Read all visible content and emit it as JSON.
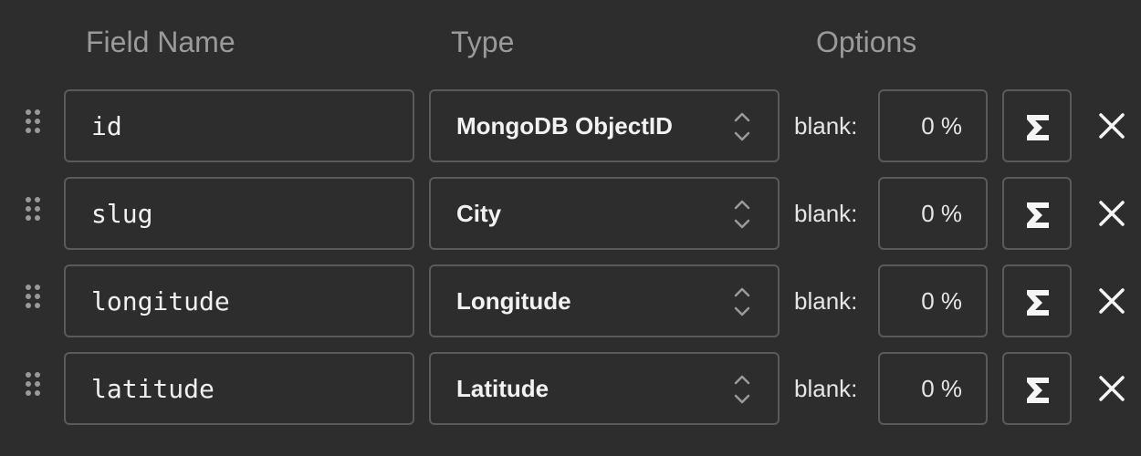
{
  "header": {
    "field_name": "Field Name",
    "type": "Type",
    "options": "Options"
  },
  "icons": {
    "drag": "drag-handle-icon",
    "select": "chevron-up-down-icon",
    "formula": "sigma-icon",
    "delete": "close-icon"
  },
  "colors": {
    "background": "#2d2d2d",
    "border": "#5a5a5a",
    "header_text": "#9a9a9a",
    "text": "#f0f0f0"
  },
  "rows": [
    {
      "field_name": "id",
      "type": "MongoDB ObjectID",
      "blank_label": "blank:",
      "blank_value": "0 %"
    },
    {
      "field_name": "slug",
      "type": "City",
      "blank_label": "blank:",
      "blank_value": "0 %"
    },
    {
      "field_name": "longitude",
      "type": "Longitude",
      "blank_label": "blank:",
      "blank_value": "0 %"
    },
    {
      "field_name": "latitude",
      "type": "Latitude",
      "blank_label": "blank:",
      "blank_value": "0 %"
    }
  ]
}
